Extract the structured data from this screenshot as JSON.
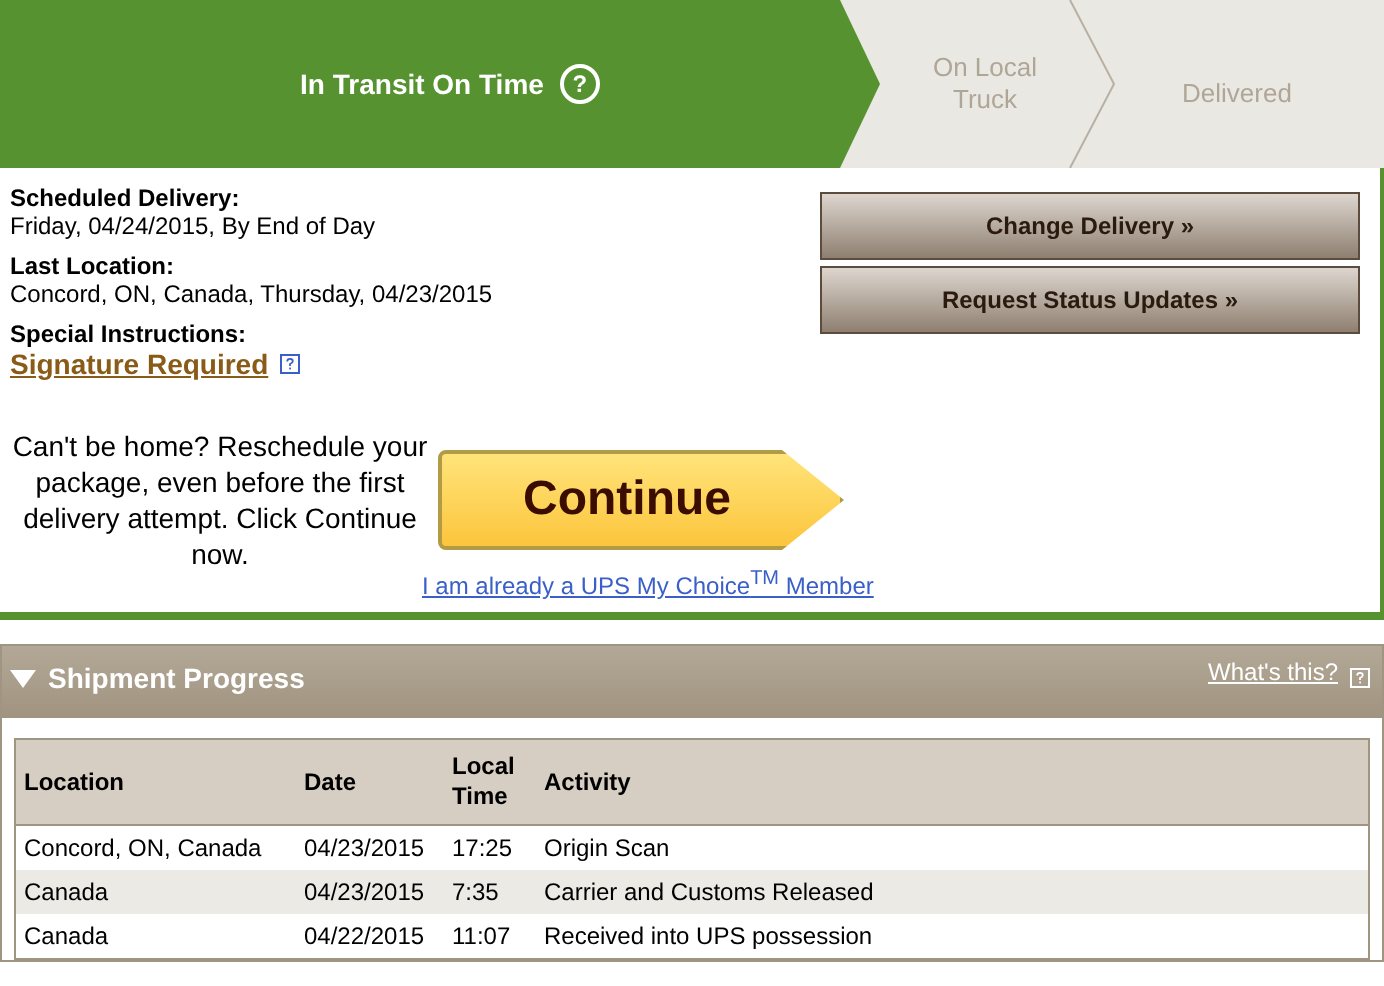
{
  "steps": [
    {
      "label": "In Transit On Time",
      "selected": true,
      "help": "?"
    },
    {
      "label": "On Local Truck",
      "selected": false
    },
    {
      "label": "Delivered",
      "selected": false
    }
  ],
  "details": [
    {
      "label": "Scheduled Delivery:",
      "value": "Friday, 04/24/2015, By End of Day",
      "kind": "text"
    },
    {
      "label": "Last Location:",
      "value": "Concord, ON, Canada, Thursday, 04/23/2015",
      "kind": "text"
    },
    {
      "label": "Special Instructions:",
      "value": "Signature Required",
      "kind": "link"
    }
  ],
  "actions": [
    "Change Delivery »",
    "Request Status Updates »"
  ],
  "reschedule": {
    "message": "Can't be home? Reschedule your package, even before the first delivery attempt. Click Continue now.",
    "button": "Continue",
    "member_link": "I am already a UPS My Choice$^{TM}$ Member"
  },
  "progress": {
    "title": "Shipment Progress",
    "expanded": true,
    "help_link": "What's this?",
    "columns": [
      "Location",
      "Date",
      "Local Time",
      "Activity"
    ],
    "rows": [
      [
        "Concord, ON, Canada",
        "04/23/2015",
        "17:25",
        "Origin Scan"
      ],
      [
        "Canada",
        "04/23/2015",
        "7:35",
        "Carrier and Customs Released"
      ],
      [
        "Canada",
        "04/22/2015",
        "11:07",
        "Received into UPS possession"
      ]
    ]
  }
}
